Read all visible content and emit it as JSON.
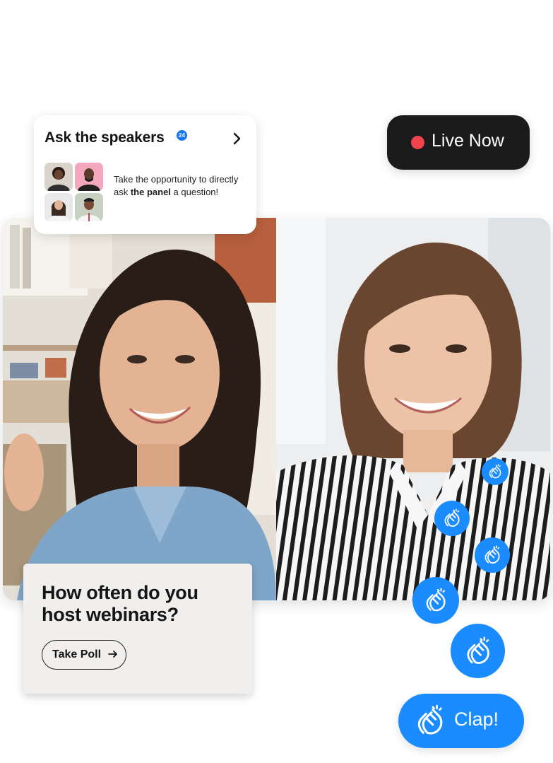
{
  "ask_card": {
    "title": "Ask the speakers",
    "badge_count": "24",
    "description_pre": "Take the opportunity to directly ask ",
    "description_bold": "the panel",
    "description_post": " a question!"
  },
  "live": {
    "label": "Live Now",
    "dot_color": "#f0434d"
  },
  "poll": {
    "question": "How often do you host webinars?",
    "button_label": "Take Poll"
  },
  "reactions": {
    "button_label": "Clap!",
    "accent_color": "#1a8cff",
    "icon": "clapping-hands-icon"
  },
  "participants": [
    {
      "tile": "left",
      "description": "smiling woman with long dark hair, denim shirt"
    },
    {
      "tile": "right",
      "description": "smiling woman with striped blouse"
    }
  ]
}
